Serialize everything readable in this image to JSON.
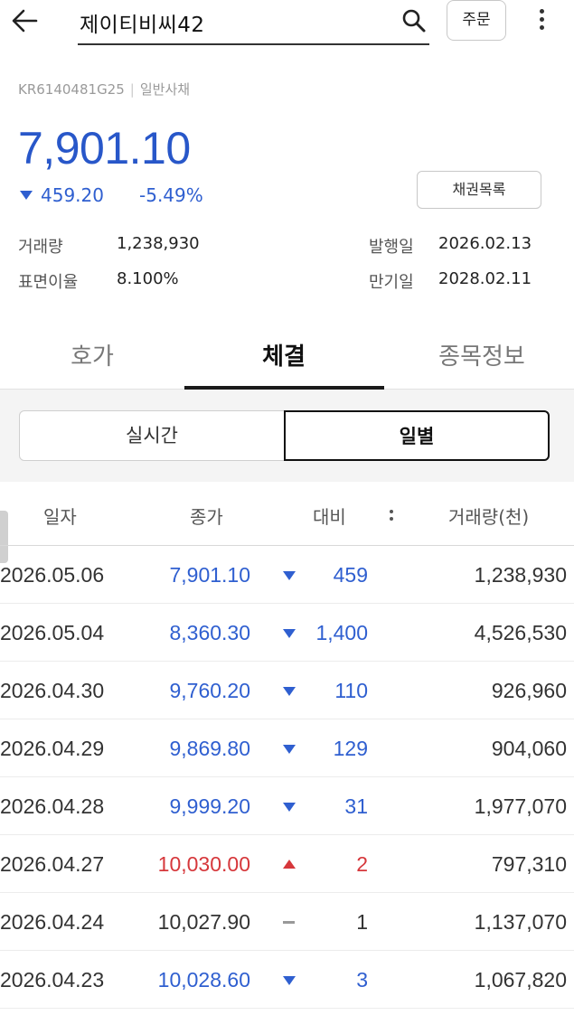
{
  "header": {
    "search_text": "제이티비씨42",
    "order_label": "주문"
  },
  "bond": {
    "code": "KR6140481G25",
    "category": "일반사채",
    "price": "7,901.10",
    "change": "459.20",
    "change_rate": "-5.49%",
    "list_button": "채권목록",
    "volume_label": "거래량",
    "volume": "1,238,930",
    "coupon_label": "표면이율",
    "coupon": "8.100%",
    "issue_label": "발행일",
    "issue_date": "2026.02.13",
    "maturity_label": "만기일",
    "maturity_date": "2028.02.11"
  },
  "tabs": [
    "호가",
    "체결",
    "종목정보"
  ],
  "segments": [
    "실시간",
    "일별"
  ],
  "table": {
    "headers": [
      "일자",
      "종가",
      "대비",
      "거래량(천)"
    ],
    "rows": [
      {
        "date": "2026.05.06",
        "close": "7,901.10",
        "dir": "down",
        "diff": "459",
        "volume": "1,238,930"
      },
      {
        "date": "2026.05.04",
        "close": "8,360.30",
        "dir": "down",
        "diff": "1,400",
        "volume": "4,526,530"
      },
      {
        "date": "2026.04.30",
        "close": "9,760.20",
        "dir": "down",
        "diff": "110",
        "volume": "926,960"
      },
      {
        "date": "2026.04.29",
        "close": "9,869.80",
        "dir": "down",
        "diff": "129",
        "volume": "904,060"
      },
      {
        "date": "2026.04.28",
        "close": "9,999.20",
        "dir": "down",
        "diff": "31",
        "volume": "1,977,070"
      },
      {
        "date": "2026.04.27",
        "close": "10,030.00",
        "dir": "up",
        "diff": "2",
        "volume": "797,310"
      },
      {
        "date": "2026.04.24",
        "close": "10,027.90",
        "dir": "flat",
        "diff": "1",
        "volume": "1,137,070"
      },
      {
        "date": "2026.04.23",
        "close": "10,028.60",
        "dir": "down",
        "diff": "3",
        "volume": "1,067,820"
      }
    ]
  },
  "colors": {
    "down": "#2f5fd0",
    "up": "#d6373b",
    "price": "#2857c9"
  }
}
